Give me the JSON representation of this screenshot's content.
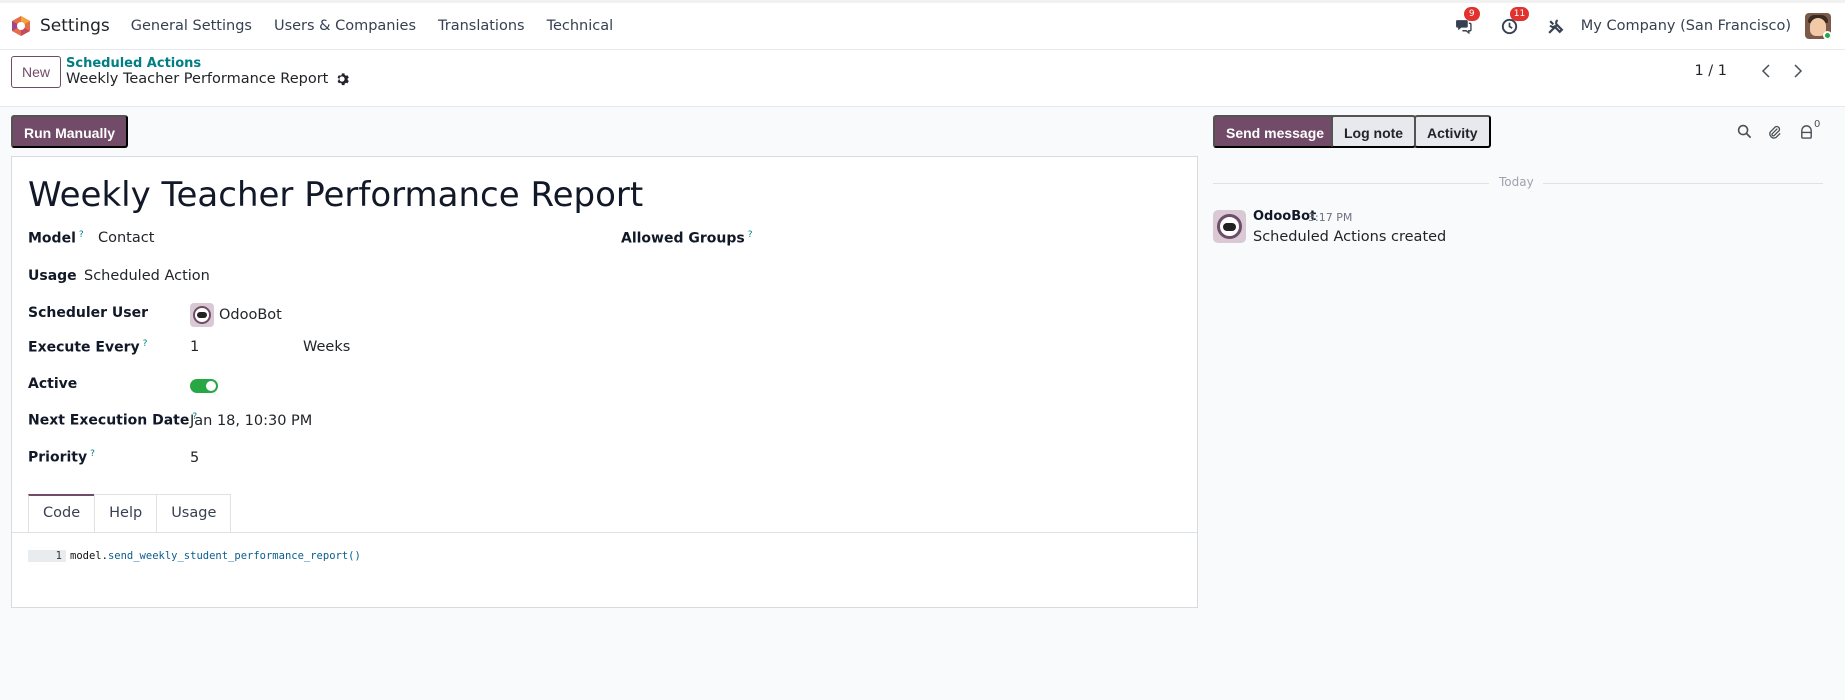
{
  "navbar": {
    "app_name": "Settings",
    "menu": [
      "General Settings",
      "Users & Companies",
      "Translations",
      "Technical"
    ],
    "messages_badge": "9",
    "activities_badge": "11",
    "company": "My Company (San Francisco)"
  },
  "control": {
    "new_label": "New",
    "breadcrumb_parent": "Scheduled Actions",
    "breadcrumb_current": "Weekly Teacher Performance Report",
    "pager": "1 / 1"
  },
  "actions": {
    "run_manually": "Run Manually"
  },
  "form": {
    "title": "Weekly Teacher Performance Report",
    "help_mark": "?",
    "fields": {
      "model_label": "Model",
      "model_value": "Contact",
      "allowed_groups_label": "Allowed Groups",
      "usage_label": "Usage",
      "usage_value": "Scheduled Action",
      "scheduler_user_label": "Scheduler User",
      "scheduler_user_value": "OdooBot",
      "execute_every_label": "Execute Every",
      "execute_every_value": "1",
      "execute_every_unit": "Weeks",
      "active_label": "Active",
      "active_value": true,
      "next_execution_label": "Next Execution Date",
      "next_execution_value": "Jan 18, 10:30 PM",
      "priority_label": "Priority",
      "priority_value": "5"
    },
    "tabs": [
      "Code",
      "Help",
      "Usage"
    ],
    "active_tab": "Code",
    "code": {
      "line_number": "1",
      "object": "model",
      "method": "send_weekly_student_performance_report()"
    }
  },
  "chatter": {
    "send_message": "Send message",
    "log_note": "Log note",
    "activity": "Activity",
    "followers_count": "0",
    "separator": "Today",
    "messages": [
      {
        "author": "OdooBot",
        "time": "3:17 PM",
        "body": "Scheduled Actions created"
      }
    ]
  },
  "colors": {
    "brand": "#714b67",
    "link": "#017e84",
    "toggle_on": "#28a745",
    "badge": "#e0322f"
  }
}
